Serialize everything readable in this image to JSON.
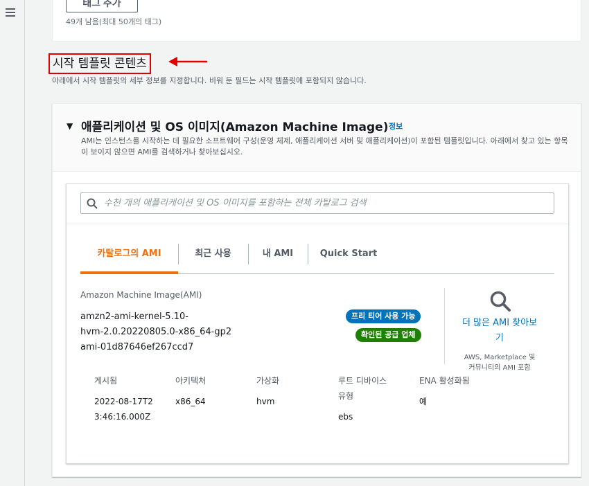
{
  "nav": {
    "menu_icon": "hamburger-menu-icon"
  },
  "tags_section": {
    "add_tag_label": "태그 추가",
    "remaining_text": "49개 남음(최대 50개의 태그)"
  },
  "launch_template": {
    "title": "시작 템플릿 콘텐츠",
    "description": "아래에서 시작 템플릿의 세부 정보를 지정합니다. 비워 둔 필드는 시작 템플릿에 포함되지 않습니다."
  },
  "ami_section": {
    "title": "애플리케이션 및 OS 이미지(Amazon Machine Image)",
    "info_link": "정보",
    "description": "AMI는 인스턴스를 시작하는 데 필요한 소프트웨어 구성(운영 체제, 애플리케이션 서버 및 애플리케이션)이 포함된 템플릿입니다. 아래에서 찾고 있는 항목이 보이지 않으면 AMI를 검색하거나 찾아보십시오.",
    "search_placeholder": "수천 개의 애플리케이션 및 OS 이미지를 포함하는 전체 카탈로그 검색",
    "tabs": [
      {
        "label": "카탈로그의 AMI",
        "active": true
      },
      {
        "label": "최근 사용",
        "active": false
      },
      {
        "label": "내 AMI",
        "active": false
      },
      {
        "label": "Quick Start",
        "active": false
      }
    ],
    "selected": {
      "label": "Amazon Machine Image(AMI)",
      "name_line1": "amzn2-ami-kernel-5.10-",
      "name_line2": "hvm-2.0.20220805.0-x86_64-gp2",
      "ami_id": "ami-01d87646ef267ccd7",
      "badge_free_tier": "프리 티어 사용 가능",
      "badge_verified": "확인된 공급 업체"
    },
    "find_more": {
      "link_line1": "더 많은 AMI 찾아보",
      "link_line2": "기",
      "note_line1": "AWS, Marketplace 및",
      "note_line2": "커뮤니티의 AMI 포함"
    },
    "details": {
      "headers": [
        "게시됨",
        "아키텍처",
        "가상화",
        "루트 디바이스",
        "유형",
        "ENA 활성화됨"
      ],
      "published_line1": "2022-08-17T2",
      "published_line2": "3:46:16.000Z",
      "architecture": "x86_64",
      "virtualization": "hvm",
      "root_device_type": "ebs",
      "ena_enabled": "예"
    }
  },
  "colors": {
    "accent_orange": "#ec7211",
    "link_blue": "#0073bb",
    "badge_green": "#1d8102",
    "highlight_red": "#e00000"
  }
}
